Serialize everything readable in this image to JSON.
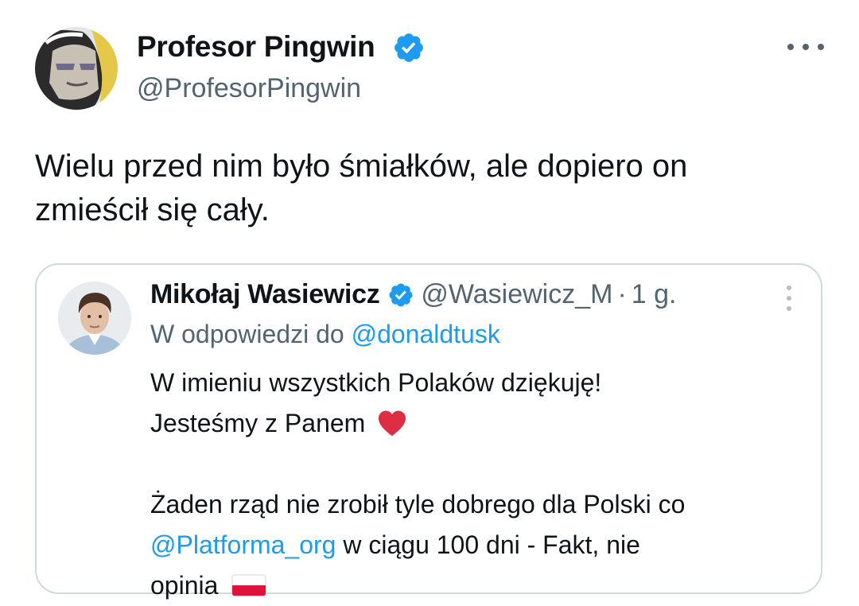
{
  "tweet": {
    "author": {
      "name": "Profesor Pingwin",
      "handle": "@ProfesorPingwin",
      "verified": true
    },
    "text_lines": [
      "Wielu przed nim było śmiałków, ale dopiero on",
      "zmieścił się cały."
    ],
    "icons": {
      "verified": "verified-badge-icon",
      "more": "more-horizontal-icon"
    }
  },
  "quote": {
    "author": {
      "name": "Mikołaj Wasiewicz",
      "handle": "@Wasiewicz_M",
      "separator": "·",
      "time": "1 g.",
      "verified": true
    },
    "reply_prefix": "W odpowiedzi do",
    "reply_mention": "@donaldtusk",
    "body": {
      "line1": "W imieniu wszystkich Polaków dziękuję!",
      "line2": "Jesteśmy z Panem",
      "line3": "Żaden rząd nie zrobił tyle dobrego dla Polski co",
      "mention": "@Platforma_org",
      "line4_rest": "w ciągu 100 dni - Fakt, nie",
      "line5": "opinia"
    },
    "emoji": {
      "heart": "red-heart",
      "flag": "poland-flag"
    }
  },
  "colors": {
    "text": "#0f1419",
    "secondary": "#536471",
    "link": "#1d9bf0",
    "border": "#cfd9de",
    "verified": "#1d9bf0"
  }
}
